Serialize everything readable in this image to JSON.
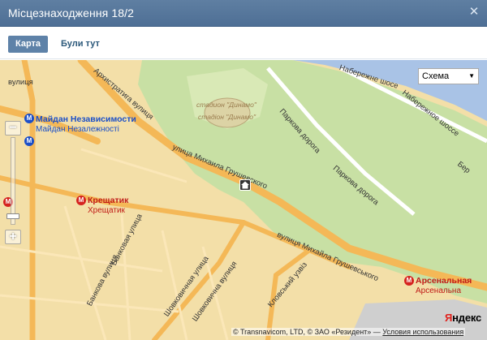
{
  "window": {
    "title": "Місцезнаходження 18/2",
    "close_glyph": "✕"
  },
  "tabs": [
    {
      "label": "Карта",
      "active": true
    },
    {
      "label": "Були тут",
      "active": false
    }
  ],
  "map": {
    "type_selector": {
      "selected": "Схема",
      "arrow": "▼"
    },
    "zoom": {
      "plus": "+",
      "minus": "−"
    },
    "metro": [
      {
        "name": "Майдан Независимости",
        "sub": "Майдан Незалежності",
        "color": "#1b4fc8"
      },
      {
        "name": "Крещатик",
        "sub": "Хрещатик",
        "color": "#d5231f"
      },
      {
        "name": "Арсенальная",
        "sub": "Арсенальна",
        "color": "#d5231f"
      }
    ],
    "streets": {
      "s1": "вулиця",
      "s2": "Архистратига вулиця",
      "s3": "улица Михаила Грушевского",
      "s4": "вулиця Михайла Грушевського",
      "s5": "Паркова дорога",
      "s6": "Паркова дорога",
      "s7": "Набережное шоссе",
      "s8": "Набережне шосе",
      "s9": "Банковая улица",
      "s10": "Банкова вулиця",
      "s11": "Шовковична вулиця",
      "s12": "Шовковичная улица",
      "s13": "Кловський узвіз",
      "s14": "Бер"
    },
    "parks": {
      "p1": "стадион \"Динамо\"",
      "p2": "стадіон \"Динамо\""
    },
    "branding": {
      "logo_first": "Я",
      "logo_rest": "ндекс"
    },
    "copyright": {
      "text": "© Transnavicom, LTD, © ЗАО «Резидент» — ",
      "link": "Условия использования"
    }
  },
  "colors": {
    "titlebar": "#5f7fa2",
    "tab_active": "#5e82a8",
    "water": "#a9c3e6",
    "park": "#c8e0a4",
    "urban": "#f3dfa8",
    "road": "#f4b857",
    "metro_blue": "#1b4fc8",
    "metro_red": "#d5231f"
  }
}
